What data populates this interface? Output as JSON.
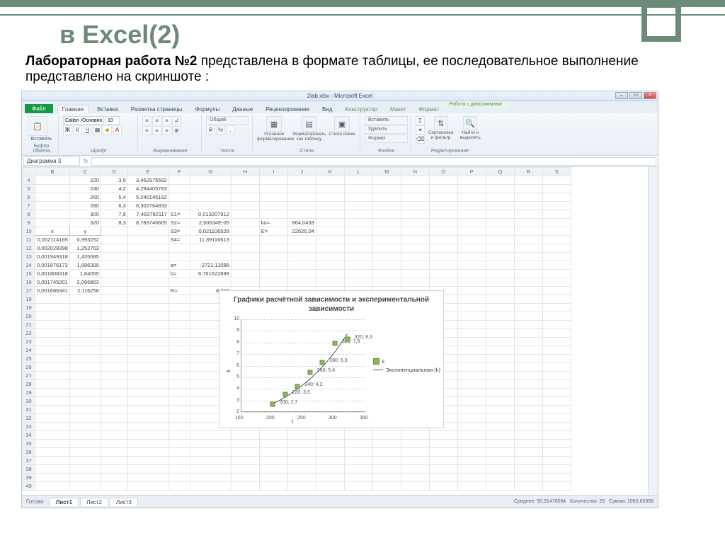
{
  "slide": {
    "title": "в  Excel(2)",
    "subtitle_bold": "Лабораторная работа №2",
    "subtitle_rest": " представлена в формате таблицы, ее последовательное выполнение представлено на скриншоте :"
  },
  "excel": {
    "title": "2lab.xlsx - Microsoft Excel",
    "file_tab": "Файл",
    "tabs": [
      "Главная",
      "Вставка",
      "Разметка страницы",
      "Формулы",
      "Данные",
      "Рецензирование",
      "Вид",
      "Конструктор",
      "Макет",
      "Формат"
    ],
    "context_title": "Работа с диаграммами",
    "ribbon": {
      "clipboard": {
        "paste": "Вставить",
        "label": "Буфер обмена"
      },
      "font": {
        "name": "Calibri (Основной",
        "size": "10",
        "label": "Шрифт"
      },
      "align": {
        "label": "Выравнивание"
      },
      "number": {
        "fmt": "Общий",
        "label": "Число"
      },
      "styles": {
        "cond": "Условное форматирование",
        "table": "Форматировать как таблицу",
        "cell": "Стили ячеек",
        "label": "Стили"
      },
      "cells": {
        "insert": "Вставить",
        "delete": "Удалить",
        "format": "Формат",
        "label": "Ячейки"
      },
      "edit": {
        "sort": "Сортировка и фильтр",
        "find": "Найти и выделить",
        "label": "Редактирование"
      }
    },
    "namebox": "Диаграмма 3",
    "fx": "fx",
    "columns": [
      "B",
      "C",
      "D",
      "E",
      "F",
      "G",
      "H",
      "I",
      "J",
      "K",
      "L",
      "M",
      "N",
      "O",
      "P",
      "Q",
      "R",
      "S"
    ],
    "rows_main": [
      {
        "r": 4,
        "B": "",
        "C": "220",
        "D": "3,5",
        "E": "3,462975592"
      },
      {
        "r": 5,
        "B": "",
        "C": "240",
        "D": "4,2",
        "E": "4,294405783"
      },
      {
        "r": 6,
        "B": "",
        "C": "260",
        "D": "5,4",
        "E": "5,240145192"
      },
      {
        "r": 7,
        "B": "",
        "C": "280",
        "D": "6,3",
        "E": "6,302764833"
      },
      {
        "r": 8,
        "B": "",
        "C": "300",
        "D": "7,9",
        "E": "7,483782117",
        "F": "S1=",
        "G": "0,013207912"
      },
      {
        "r": 9,
        "B": "",
        "C": "320",
        "D": "8,3",
        "E": "8,783746605",
        "F": "S2=",
        "G": "2,50634E-05",
        "I": "ko=",
        "J": "864,0433"
      },
      {
        "r": 10,
        "B_hdr": "x",
        "C_hdr": "y",
        "F": "S3=",
        "G": "0,021106528",
        "I": "E=",
        "J": "22626,04"
      },
      {
        "r": 11,
        "B": "0,002114165",
        "C": "0,993252",
        "F": "S4=",
        "G": "11,39116613"
      },
      {
        "r": 12,
        "B": "0,002028398",
        "C": "1,252763"
      },
      {
        "r": 13,
        "B": "0,001949318",
        "C": "1,435085"
      },
      {
        "r": 14,
        "B": "0,001876173",
        "C": "1,686399",
        "F": "a=",
        "G": "-2721,11088"
      },
      {
        "r": 15,
        "B": "0,001808318",
        "C": "1,84055",
        "F": "b=",
        "G": "6,761622899"
      },
      {
        "r": 16,
        "B": "0,001745201",
        "C": "2,066863"
      },
      {
        "r": 17,
        "B": "0,001686341",
        "C": "2,116256",
        "F": "R=",
        "G": "8,315"
      }
    ],
    "empty_rows": [
      18,
      19,
      20,
      21,
      22,
      23,
      24,
      25,
      26,
      27,
      28,
      29,
      30,
      31,
      32,
      33,
      34,
      35,
      36,
      37,
      38,
      39,
      40
    ],
    "sheets": [
      "Лист1",
      "Лист2",
      "Лист3"
    ],
    "status": {
      "ready": "Готово",
      "avg": "Среднее: 90,31476094",
      "count": "Количество: 25",
      "sum": "Сумма: 1090,60998"
    }
  },
  "chart_data": {
    "type": "scatter",
    "title": "Графики расчётной зависимости и экспериментальной зависимости",
    "xlabel": "t",
    "ylabel": "k",
    "xlim": [
      150,
      350
    ],
    "ylim": [
      2,
      10
    ],
    "xticks": [
      150,
      200,
      250,
      300,
      350
    ],
    "yticks": [
      2,
      3,
      4,
      5,
      6,
      7,
      8,
      9,
      10
    ],
    "series": [
      {
        "name": "k",
        "type": "marker",
        "x": [
          200,
          220,
          240,
          260,
          280,
          300,
          320
        ],
        "y": [
          2.7,
          3.5,
          4.2,
          5.4,
          6.3,
          7.9,
          8.3
        ],
        "labels": [
          "200; 2,7",
          "220; 3,5",
          "240; 4,2",
          "260; 5,4",
          "280; 6,3",
          "300; 7,9",
          "320; 8,3"
        ]
      },
      {
        "name": "Экспоненциальная (k)",
        "type": "line"
      }
    ]
  }
}
